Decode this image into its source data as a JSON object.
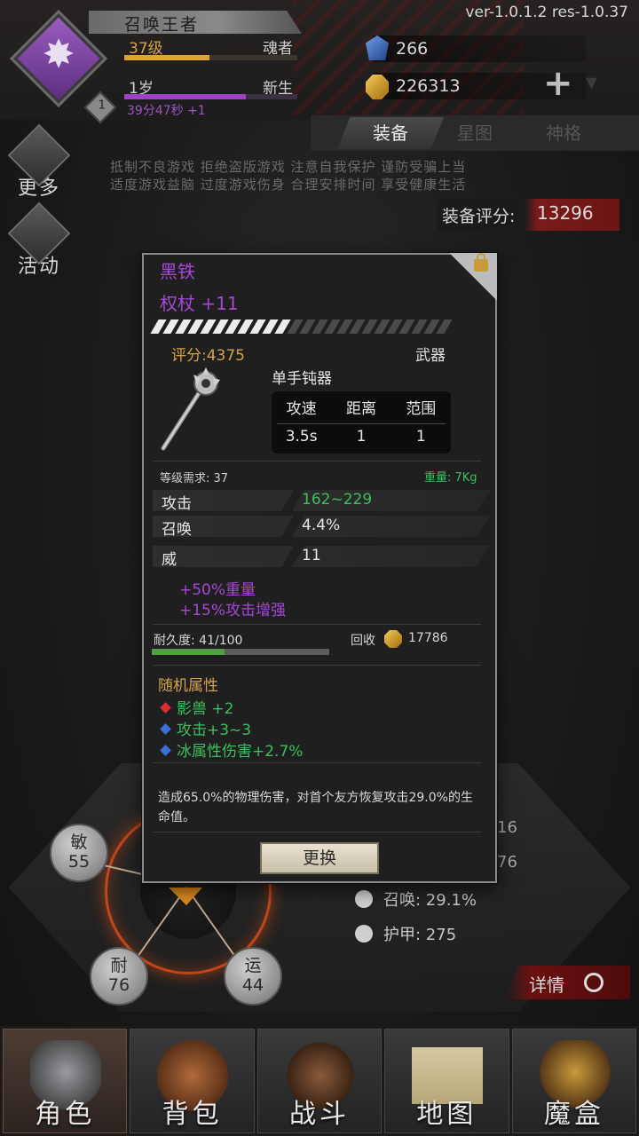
{
  "header": {
    "version": "ver-1.0.1.2  res-1.0.37",
    "player_name": "召唤王者",
    "level": "37级",
    "level_title": "魂者",
    "age": "1岁",
    "age_title": "新生",
    "timer": "39分47秒 +1",
    "avatar_badge": "1",
    "level_progress": 0.49,
    "age_progress": 0.7,
    "gems": "266",
    "gold": "226313"
  },
  "tabs": [
    "装备",
    "星图",
    "神格"
  ],
  "side": {
    "more": "更多",
    "activity": "活动"
  },
  "notice": {
    "line1": "抵制不良游戏 拒绝盗版游戏 注意自我保护 谨防受骗上当",
    "line2": "适度游戏益脑 过度游戏伤身 合理安排时间 享受健康生活"
  },
  "score": {
    "label": "装备评分:",
    "value": "13296"
  },
  "item": {
    "name_line1": "黑铁",
    "name_line2": "权杖 +11",
    "progress": 0.46,
    "score": "评分:4375",
    "type": "武器",
    "sub_type": "单手钝器",
    "spec_headers": [
      "攻速",
      "距离",
      "范围"
    ],
    "spec_values": [
      "3.5s",
      "1",
      "1"
    ],
    "requirement": "等级需求: 37",
    "weight": "重量: 7Kg",
    "attributes": [
      {
        "key": "攻击",
        "value": "162~229"
      },
      {
        "key": "召唤",
        "value": "4.4%"
      },
      {
        "key": "威",
        "value": "11"
      }
    ],
    "bonuses": [
      "+50%重量",
      "+15%攻击增强"
    ],
    "durability_label": "耐久度: 41/100",
    "durability": 0.41,
    "recycle_label": "回收",
    "recycle_value": "17786",
    "random_title": "随机属性",
    "random_attrs": [
      "影兽 +2",
      "攻击+3~3",
      "冰属性伤害+2.7%"
    ],
    "random_colors": [
      "#d83030",
      "#3a6fd8",
      "#3a6fd8"
    ],
    "description": "造成65.0%的物理伤害，对首个友方恢复攻击29.0%的生命值。",
    "swap_button": "更换"
  },
  "stats": {
    "agility_label": "敏",
    "agility_value": "55",
    "durability_label": "耐",
    "durability_value": "76",
    "luck_label": "运",
    "luck_value": "44",
    "partial_1": "16",
    "partial_2": "76",
    "summon": "召唤: 29.1%",
    "armor": "护甲: 275",
    "detail_button": "详情"
  },
  "nav": [
    "角色",
    "背包",
    "战斗",
    "地图",
    "魔盒"
  ],
  "colors": {
    "purple": "#a548d8",
    "gold": "#d4a24a",
    "green": "#3cbf5c"
  }
}
